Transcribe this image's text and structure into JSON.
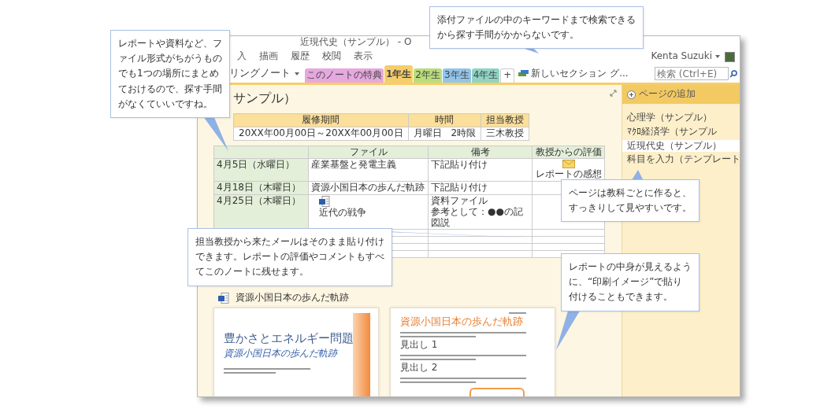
{
  "window": {
    "title": "近現代史（サンプル） - O"
  },
  "ribbon_tabs": [
    "入",
    "描画",
    "履歴",
    "校閲",
    "表示"
  ],
  "user": {
    "name": "Kenta Suzuki"
  },
  "notebook": {
    "name": "リングノート"
  },
  "sections": [
    {
      "label": "このノートの特典",
      "color": "#e6a8de",
      "selected": false
    },
    {
      "label": "1年生",
      "color": "#f5cd6b",
      "selected": true
    },
    {
      "label": "2年生",
      "color": "#b9dc7e",
      "selected": false
    },
    {
      "label": "3年生",
      "color": "#93c4ea",
      "selected": false
    },
    {
      "label": "4年生",
      "color": "#8fd4c4",
      "selected": false
    }
  ],
  "add_section": "+",
  "new_section_group": "新しいセクション グ...",
  "search": {
    "placeholder": "検索 (Ctrl+E)"
  },
  "page": {
    "title": "サンプル）",
    "term_table": {
      "columns": [
        "履修期間",
        "時間",
        "担当教授"
      ],
      "row": [
        "20XX年00月00日～20XX年00月00日",
        "月曜日　2時限",
        "三木教授"
      ]
    },
    "schedule_table": {
      "columns": [
        "ファイル",
        "備考",
        "教授からの評価"
      ],
      "rows": [
        {
          "kind": "entry",
          "date": "4月5日（水曜日）",
          "file": {
            "kind": "text",
            "text": "産業基盤と発電主義"
          },
          "notes": [
            "下記貼り付け"
          ],
          "evaluation": {
            "kind": "mail",
            "text": "レポートの感想"
          }
        },
        {
          "kind": "entry",
          "date": "4月18日（木曜日）",
          "file": {
            "kind": "text",
            "text": "資源小国日本の歩んだ軌跡"
          },
          "notes": [
            "下記貼り付け"
          ]
        },
        {
          "kind": "entry",
          "date": "4月25日（木曜日）",
          "file": {
            "kind": "attachment",
            "text": "近代の戦争"
          },
          "notes": [
            "資料ファイル",
            "参考として：●●の記",
            "図説"
          ]
        },
        {
          "kind": "blank"
        },
        {
          "kind": "blank"
        },
        {
          "kind": "blank"
        },
        {
          "kind": "blank"
        }
      ]
    },
    "attachment": {
      "name": "資源小国日本の歩んだ軌跡"
    },
    "printouts": [
      {
        "kind": "cover",
        "title": "豊かさとエネルギー問題",
        "subtitle": "資源小国日本の歩んだ軌跡"
      },
      {
        "kind": "report",
        "title": "資源小国日本の歩んだ軌跡",
        "headings": [
          "見出し 1",
          "見出し 2"
        ]
      }
    ]
  },
  "page_list": {
    "add_label": "ページの追加",
    "pages": [
      {
        "title": "心理学（サンプル）",
        "selected": false
      },
      {
        "title": "ﾏｸﾛ経済学（サンプル",
        "selected": false
      },
      {
        "title": "近現代史（サンプル）",
        "selected": true
      },
      {
        "title": "科目を入力（テンプレート",
        "selected": false
      }
    ]
  },
  "callouts": [
    {
      "text": "レポートや資料など、ファイル形式がちがうものでも1つの場所にまとめておけるので、探す手間がなくていいですね。"
    },
    {
      "text": "添付ファイルの中のキーワードまで検索できるから探す手間がかからないです。"
    },
    {
      "text": "ページは教科ごとに作ると、すっきりして見やすいです。"
    },
    {
      "text": "担当教授から来たメールはそのまま貼り付けできます。レポートの評価やコメントもすべてこのノートに残せます。"
    },
    {
      "text": "レポートの中身が見えるように、“印刷イメージ”で貼り付けることもできます。"
    }
  ]
}
